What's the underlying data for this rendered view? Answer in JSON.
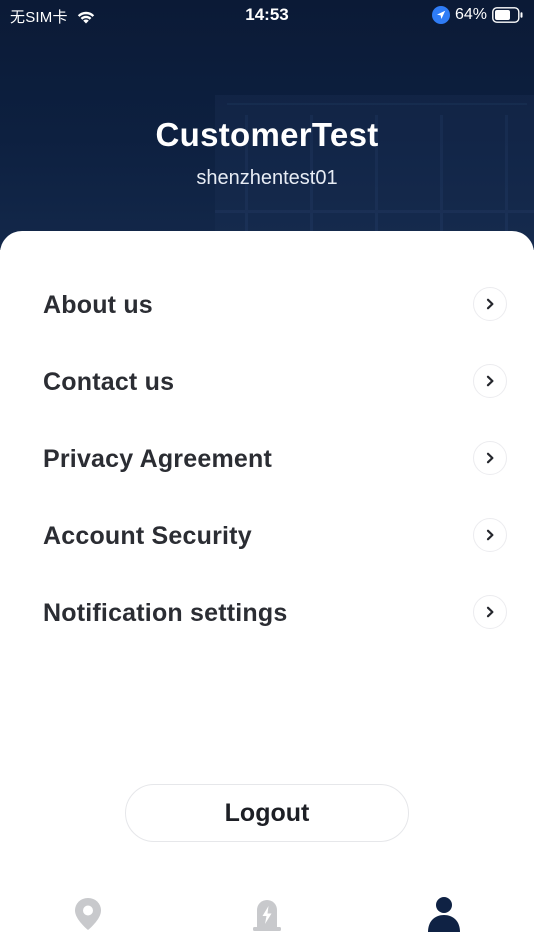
{
  "status_bar": {
    "carrier": "无SIM卡",
    "time": "14:53",
    "battery": "64%"
  },
  "profile": {
    "name": "CustomerTest",
    "username": "shenzhentest01"
  },
  "menu": {
    "items": [
      {
        "label": "About us"
      },
      {
        "label": "Contact us"
      },
      {
        "label": "Privacy Agreement"
      },
      {
        "label": "Account Security"
      },
      {
        "label": "Notification settings"
      }
    ]
  },
  "logout_label": "Logout",
  "tabs": [
    {
      "icon": "map-pin-icon",
      "active": false
    },
    {
      "icon": "charging-station-icon",
      "active": false
    },
    {
      "icon": "person-icon",
      "active": true
    }
  ],
  "colors": {
    "header_bg": "#0b1a36",
    "text_primary": "#2b2d33",
    "tab_active": "#0f2244",
    "tab_inactive": "#c8c9cc",
    "status_location": "#2f7cf6"
  }
}
